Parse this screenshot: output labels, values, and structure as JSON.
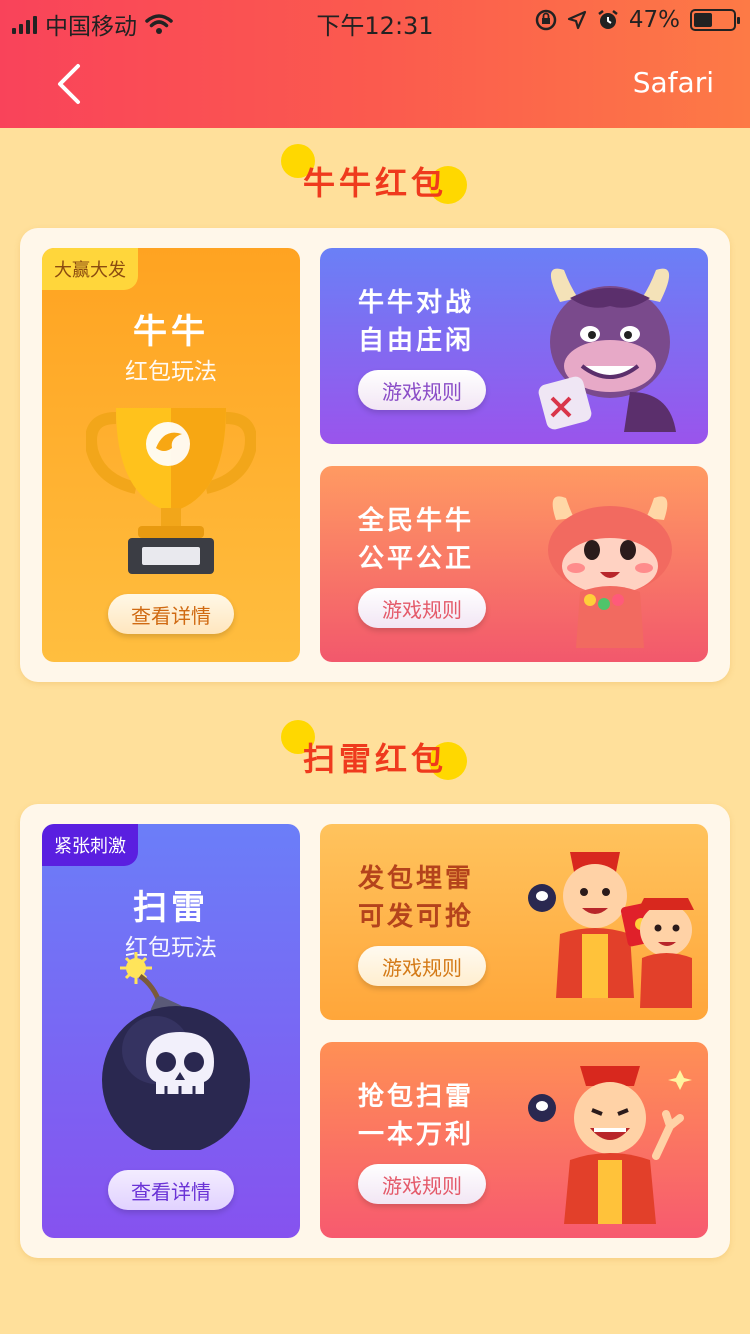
{
  "status_bar": {
    "carrier": "中国移动",
    "time": "下午12:31",
    "battery": "47%",
    "battery_level": 0.47
  },
  "nav": {
    "back_icon": "chevron-left-icon",
    "right_link": "Safari"
  },
  "sections": [
    {
      "title": "牛牛红包",
      "feature": {
        "badge": "大赢大发",
        "title": "牛牛",
        "subtitle": "红包玩法",
        "button": "查看详情",
        "icon": "trophy-icon"
      },
      "cards": [
        {
          "title_line1": "牛牛对战",
          "title_line2": "自由庄闲",
          "button": "游戏规则",
          "icon": "bull-warrior-icon"
        },
        {
          "title_line1": "全民牛牛",
          "title_line2": "公平公正",
          "button": "游戏规则",
          "icon": "bull-mascot-icon"
        }
      ]
    },
    {
      "title": "扫雷红包",
      "feature": {
        "badge": "紧张刺激",
        "title": "扫雷",
        "subtitle": "红包玩法",
        "button": "查看详情",
        "icon": "bomb-icon"
      },
      "cards": [
        {
          "title_line1": "发包埋雷",
          "title_line2": "可发可抢",
          "button": "游戏规则",
          "icon": "god-of-wealth-pair-icon"
        },
        {
          "title_line1": "抢包扫雷",
          "title_line2": "一本万利",
          "button": "游戏规则",
          "icon": "god-of-wealth-icon"
        }
      ]
    }
  ]
}
